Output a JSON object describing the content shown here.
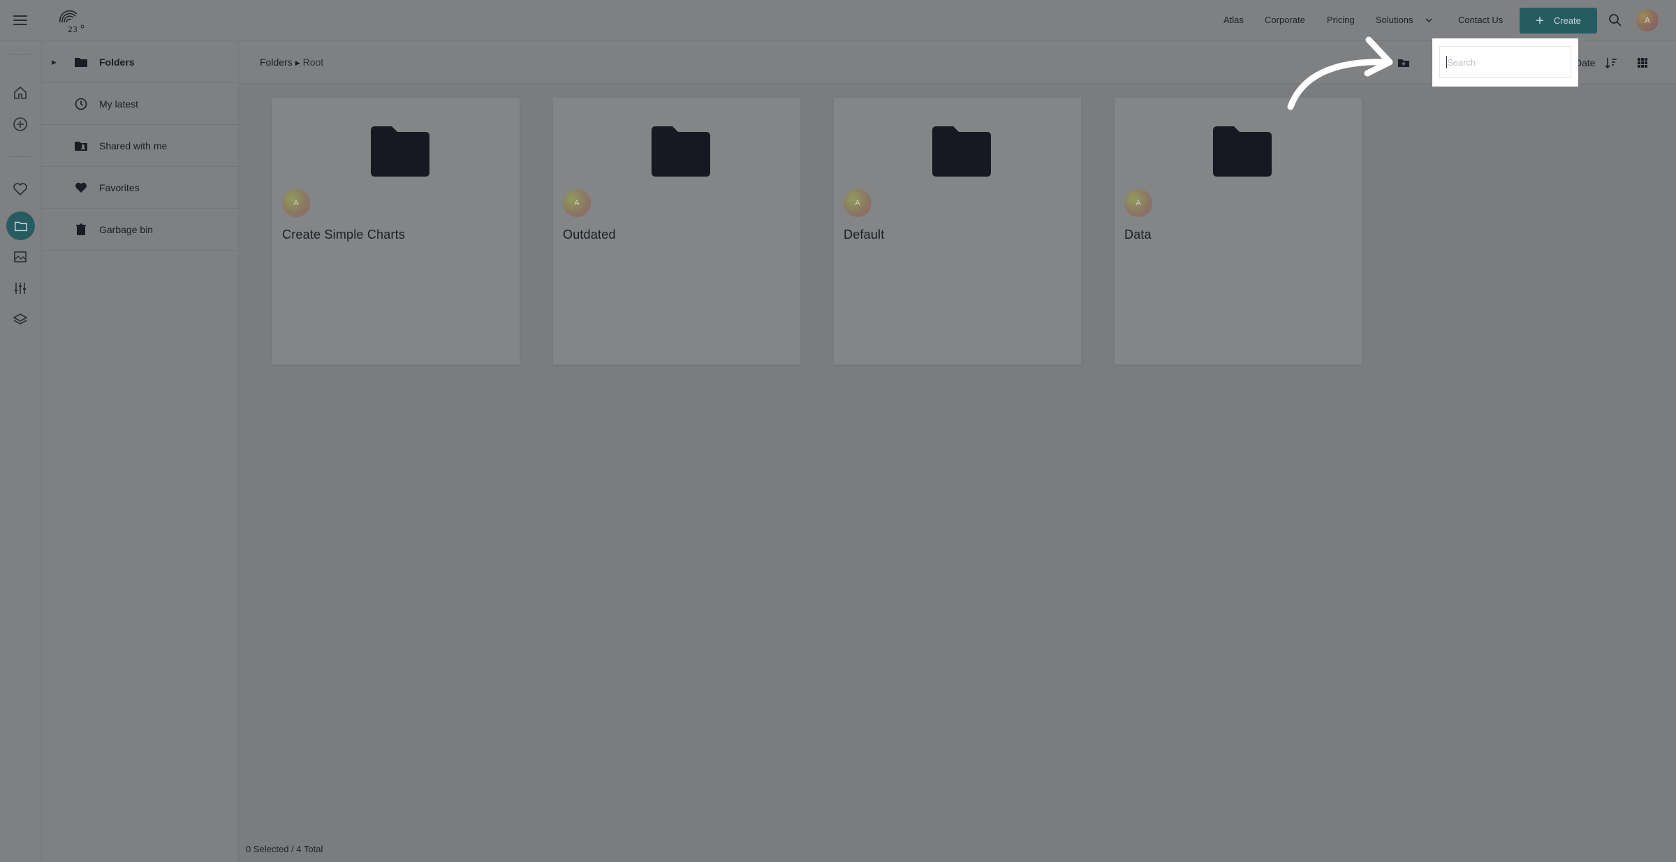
{
  "header": {
    "menu_icon": "hamburger-icon",
    "logo_icon": "logo-23-icon",
    "nav": [
      "Atlas",
      "Corporate",
      "Pricing",
      "Solutions",
      "Contact Us"
    ],
    "create_label": "Create",
    "avatar_initial": "A",
    "accent_color": "#265c61"
  },
  "rail": {
    "icons": [
      "home-icon",
      "add-circle-icon",
      "heart-icon",
      "folder-icon",
      "image-icon",
      "sliders-icon",
      "layers-icon"
    ],
    "active": "folder-icon"
  },
  "sidebar": {
    "items": [
      {
        "label": "Folders",
        "icon": "folder-icon"
      },
      {
        "label": "My latest",
        "icon": "clock-icon"
      },
      {
        "label": "Shared with me",
        "icon": "shared-folder-icon"
      },
      {
        "label": "Favorites",
        "icon": "heart-icon"
      },
      {
        "label": "Garbage bin",
        "icon": "trash-icon"
      }
    ]
  },
  "breadcrumb": {
    "parent": "Folders",
    "current": "Root"
  },
  "toolbar": {
    "sort_label": "Date",
    "search_placeholder": "Search"
  },
  "cards": [
    {
      "title": "Create Simple Charts",
      "owner": "A"
    },
    {
      "title": "Outdated",
      "owner": "A"
    },
    {
      "title": "Default",
      "owner": "A"
    },
    {
      "title": "Data",
      "owner": "A"
    }
  ],
  "status": "0 Selected / 4 Total"
}
